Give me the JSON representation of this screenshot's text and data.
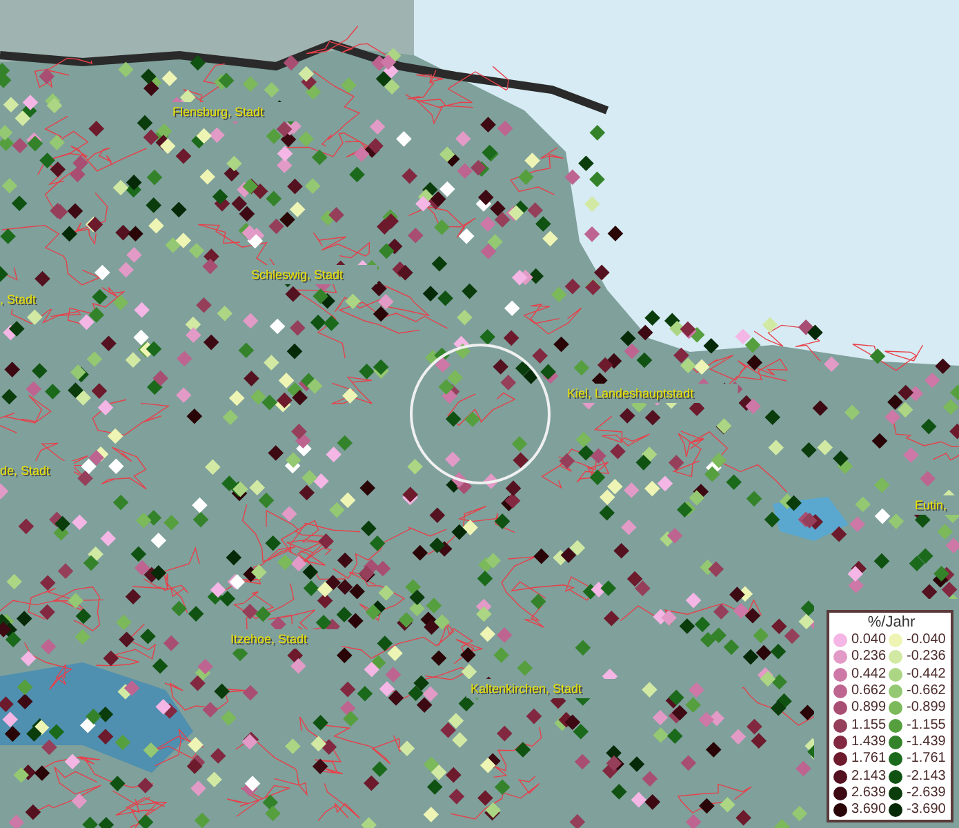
{
  "map": {
    "place_labels": [
      {
        "text": "Flensburg, Stadt"
      },
      {
        "text": "Schleswig, Stadt"
      },
      {
        "text": ", Stadt"
      },
      {
        "text": "Kiel, Landeshauptstadt"
      },
      {
        "text": "de, Stadt"
      },
      {
        "text": "Eutin,"
      },
      {
        "text": "Itzehoe, Stadt"
      },
      {
        "text": "Kaltenkirchen, Stadt"
      }
    ]
  },
  "legend": {
    "title": "%/Jahr",
    "rows": [
      {
        "positive": {
          "value": "0.040",
          "color": "#f4b6e4"
        },
        "negative": {
          "value": "-0.040",
          "color": "#eef5b4"
        }
      },
      {
        "positive": {
          "value": "0.236",
          "color": "#e29ac6"
        },
        "negative": {
          "value": "-0.236",
          "color": "#d2e9a4"
        }
      },
      {
        "positive": {
          "value": "0.442",
          "color": "#cd78a6"
        },
        "negative": {
          "value": "-0.442",
          "color": "#acd683"
        }
      },
      {
        "positive": {
          "value": "0.662",
          "color": "#bd6590"
        },
        "negative": {
          "value": "-0.662",
          "color": "#94c872"
        }
      },
      {
        "positive": {
          "value": "0.899",
          "color": "#a84e72"
        },
        "negative": {
          "value": "-0.899",
          "color": "#7bb95a"
        }
      },
      {
        "positive": {
          "value": "1.155",
          "color": "#953f5b"
        },
        "negative": {
          "value": "-1.155",
          "color": "#569f3e"
        }
      },
      {
        "positive": {
          "value": "1.439",
          "color": "#822840"
        },
        "negative": {
          "value": "-1.439",
          "color": "#34832a"
        }
      },
      {
        "positive": {
          "value": "1.761",
          "color": "#6c1a2c"
        },
        "negative": {
          "value": "-1.761",
          "color": "#1b6a1c"
        }
      },
      {
        "positive": {
          "value": "2.143",
          "color": "#54111f"
        },
        "negative": {
          "value": "-2.143",
          "color": "#105212"
        }
      },
      {
        "positive": {
          "value": "2.639",
          "color": "#3d0a13"
        },
        "negative": {
          "value": "-2.639",
          "color": "#0a3c0c"
        }
      },
      {
        "positive": {
          "value": "3.690",
          "color": "#2a0508"
        },
        "negative": {
          "value": "-3.690",
          "color": "#062a08"
        }
      }
    ]
  }
}
